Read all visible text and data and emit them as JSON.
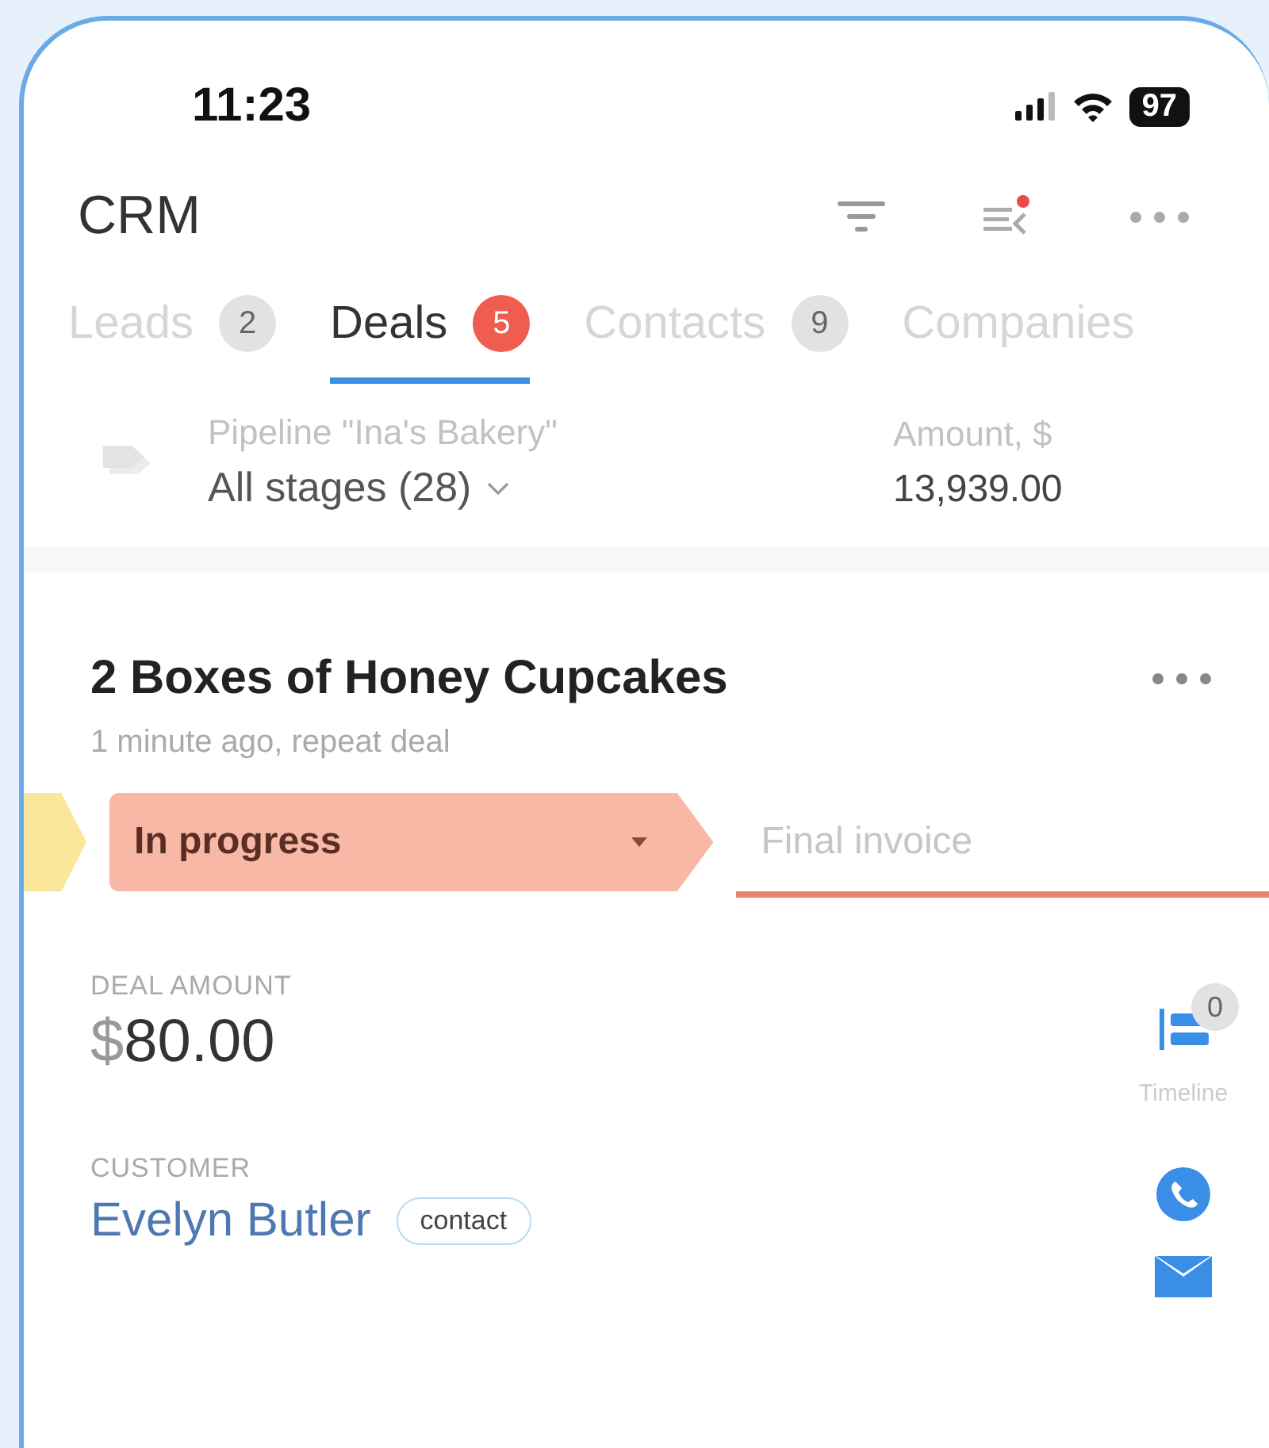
{
  "status_bar": {
    "time": "11:23",
    "battery": "97"
  },
  "header": {
    "title": "CRM"
  },
  "tabs": [
    {
      "label": "Leads",
      "count": "2",
      "selected": false
    },
    {
      "label": "Deals",
      "count": "5",
      "selected": true,
      "alert": true
    },
    {
      "label": "Contacts",
      "count": "9",
      "selected": false
    },
    {
      "label": "Companies",
      "selected": false
    }
  ],
  "pipeline": {
    "label": "Pipeline \"Ina's Bakery\"",
    "stage_filter": "All stages (28)"
  },
  "amount": {
    "label": "Amount, $",
    "value": "13,939.00"
  },
  "deal": {
    "title": "2 Boxes of Honey Cupcakes",
    "subtitle": "1 minute ago, repeat deal",
    "stages": [
      {
        "kind": "previous",
        "color": "#fbe79c"
      },
      {
        "kind": "current",
        "label": "In progress",
        "color": "#f9b8a6"
      },
      {
        "kind": "next",
        "label": "Final invoice",
        "color": "#e8826a"
      }
    ],
    "deal_amount": {
      "label": "DEAL AMOUNT",
      "currency": "$",
      "value": "80.00"
    },
    "customer": {
      "label": "CUSTOMER",
      "name": "Evelyn Butler",
      "tag": "contact"
    },
    "timeline": {
      "label": "Timeline",
      "count": "0"
    }
  }
}
